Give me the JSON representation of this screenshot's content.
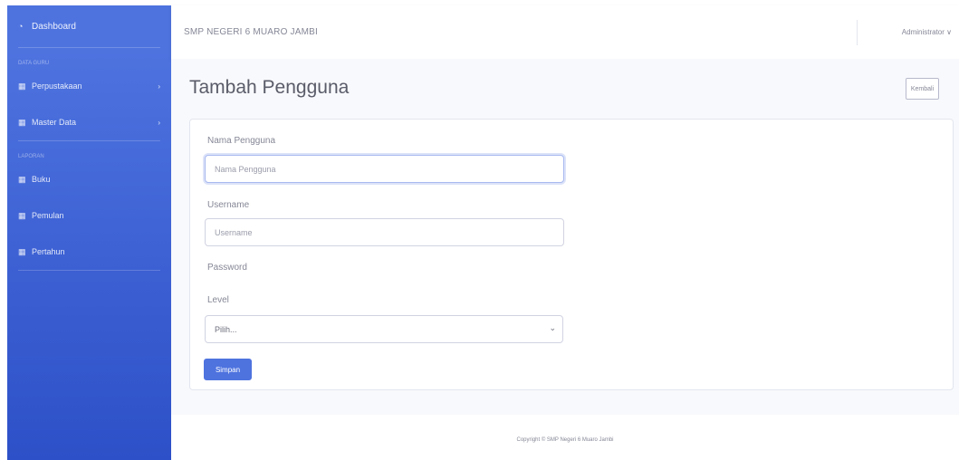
{
  "sidebar": {
    "brand": {
      "icon": "gauge-icon",
      "label": "Dashboard"
    },
    "heading_1": "Data Guru",
    "items_1": [
      {
        "icon": "table-icon",
        "label": "Perpustakaan",
        "has_chevron": true
      },
      {
        "icon": "table-icon",
        "label": "Master Data",
        "has_chevron": true
      }
    ],
    "heading_2": "Laporan",
    "items_2": [
      {
        "icon": "table-icon",
        "label": "Buku"
      },
      {
        "icon": "table-icon",
        "label": "Pemulan"
      },
      {
        "icon": "table-icon",
        "label": "Pertahun"
      }
    ],
    "colors": {
      "gradient_top": "#4e73df",
      "gradient_bottom": "#2d50c8"
    }
  },
  "topbar": {
    "title": "SMP NEGERI 6 MUARO JAMBI",
    "user": "Administrator"
  },
  "page": {
    "title": "Tambah Pengguna",
    "back_label": "Kembali"
  },
  "form": {
    "name_label": "Nama Pengguna",
    "name_placeholder": "Nama Pengguna",
    "username_label": "Username",
    "username_placeholder": "Username",
    "password_label": "Password",
    "level_label": "Level",
    "level_selected": "Pilih...",
    "save_label": "Simpan"
  },
  "footer": {
    "copyright": "Copyright © SMP Negeri 6 Muaro Jambi"
  },
  "theme": {
    "primary": "#4e73df"
  }
}
